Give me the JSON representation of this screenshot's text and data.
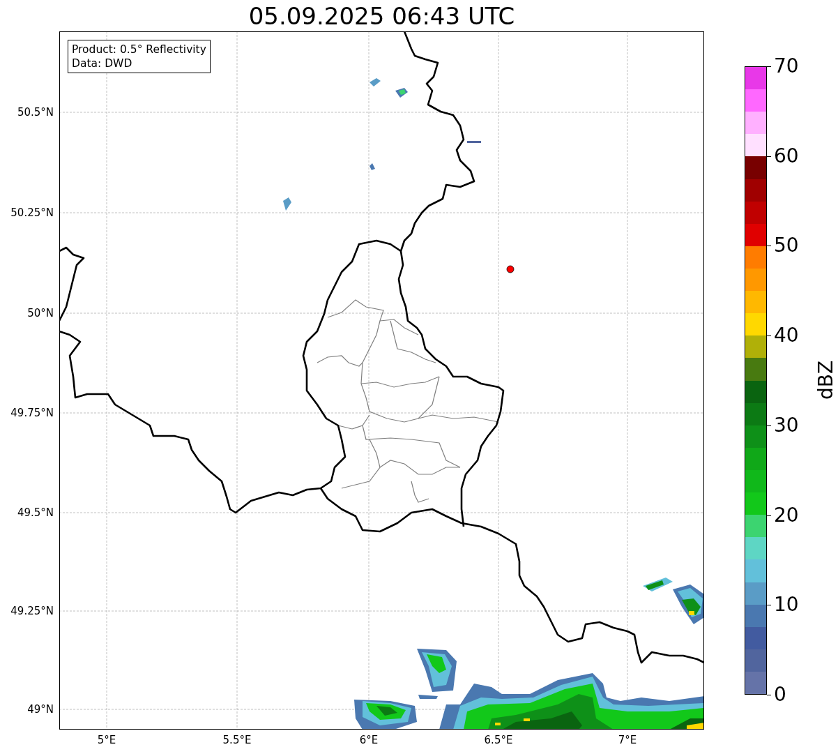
{
  "title": "05.09.2025 06:43 UTC",
  "legend": {
    "lines": [
      "Product: 0.5° Reflectivity",
      "Data: DWD"
    ]
  },
  "map": {
    "yticks": [
      "50.5°N",
      "50.25°N",
      "50°N",
      "49.75°N",
      "49.5°N",
      "49.25°N",
      "49°N"
    ],
    "xticks": [
      "5°E",
      "5.5°E",
      "6°E",
      "6.5°E",
      "7°E"
    ]
  },
  "colorbar": {
    "label": "dBZ",
    "ticks": [
      "70",
      "60",
      "50",
      "40",
      "30",
      "20",
      "10",
      "0"
    ],
    "bins": [
      {
        "color": "#e838e8"
      },
      {
        "color": "#ff68ff"
      },
      {
        "color": "#ffb0ff"
      },
      {
        "color": "#ffe0ff"
      },
      {
        "color": "#780000"
      },
      {
        "color": "#a00000"
      },
      {
        "color": "#c00000"
      },
      {
        "color": "#e00000"
      },
      {
        "color": "#ff7c00"
      },
      {
        "color": "#ff9800"
      },
      {
        "color": "#ffb800"
      },
      {
        "color": "#ffd800"
      },
      {
        "color": "#b0b008"
      },
      {
        "color": "#487a10"
      },
      {
        "color": "#0a6410"
      },
      {
        "color": "#0c7a14"
      },
      {
        "color": "#0e9018"
      },
      {
        "color": "#10a818"
      },
      {
        "color": "#10b81a"
      },
      {
        "color": "#12c81a"
      },
      {
        "color": "#3cd470"
      },
      {
        "color": "#5ed6c4"
      },
      {
        "color": "#62c0da"
      },
      {
        "color": "#5a9cc6"
      },
      {
        "color": "#4a78b0"
      },
      {
        "color": "#425ba0"
      },
      {
        "color": "#51659e"
      },
      {
        "color": "#6573a8"
      }
    ]
  }
}
